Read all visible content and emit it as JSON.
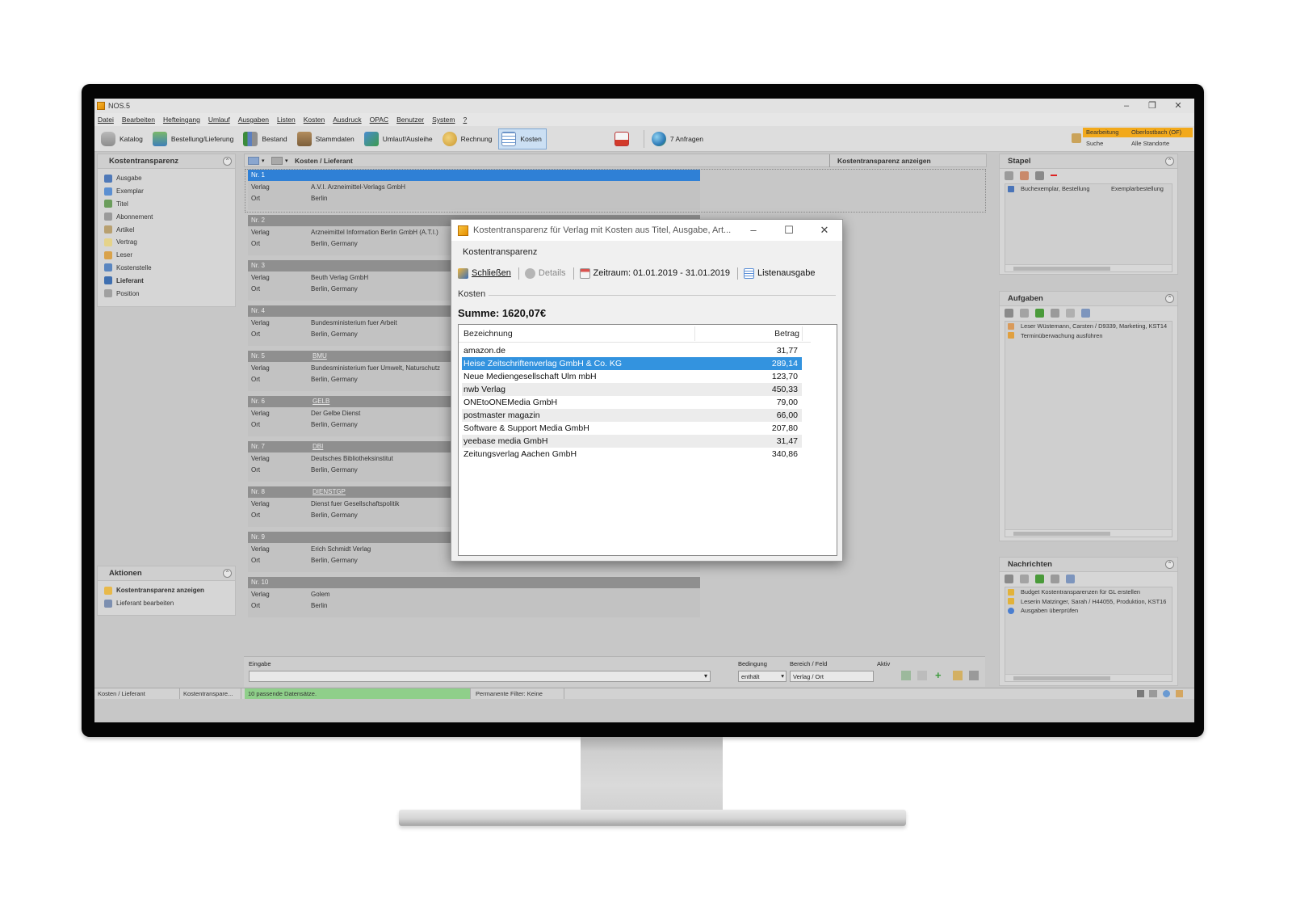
{
  "app": {
    "title": "NOS.5",
    "menu": [
      "Datei",
      "Bearbeiten",
      "Hefteingang",
      "Umlauf",
      "Ausgaben",
      "Listen",
      "Kosten",
      "Ausdruck",
      "OPAC",
      "Benutzer",
      "System",
      "?"
    ],
    "toolbar": {
      "buttons": [
        "Katalog",
        "Bestellung/Lieferung",
        "Bestand",
        "Stammdaten",
        "Umlauf/Ausleihe",
        "Rechnung",
        "Kosten"
      ],
      "requests": "7 Anfragen",
      "mode_label": "Bearbeitung",
      "mode_value": "Oberlostbach (OF)",
      "search_label": "Suche",
      "search_value": "Alle Standorte"
    }
  },
  "left_panel": {
    "title": "Kostentransparenz",
    "items": [
      "Ausgabe",
      "Exemplar",
      "Titel",
      "Abonnement",
      "Artikel",
      "Vertrag",
      "Leser",
      "Kostenstelle",
      "Lieferant",
      "Position"
    ],
    "selected": "Lieferant"
  },
  "actions_panel": {
    "title": "Aktionen",
    "items": [
      "Kostentransparenz anzeigen",
      "Lieferant bearbeiten"
    ]
  },
  "center": {
    "header_left": "Kosten / Lieferant",
    "header_right": "Kostentransparenz anzeigen",
    "records": [
      {
        "nr": "Nr. 1",
        "tag": "",
        "verlag_label": "Verlag",
        "verlag": "A.V.I. Arzneimittel-Verlags GmbH",
        "ort_label": "Ort",
        "ort": "Berlin"
      },
      {
        "nr": "Nr. 2",
        "tag": "",
        "verlag_label": "Verlag",
        "verlag": "Arzneimittel Information Berlin GmbH (A.T.I.)",
        "ort_label": "Ort",
        "ort": "Berlin, Germany"
      },
      {
        "nr": "Nr. 3",
        "tag": "",
        "verlag_label": "Verlag",
        "verlag": "Beuth Verlag GmbH",
        "ort_label": "Ort",
        "ort": "Berlin, Germany"
      },
      {
        "nr": "Nr. 4",
        "tag": "",
        "verlag_label": "Verlag",
        "verlag": "Bundesministerium fuer Arbeit",
        "ort_label": "Ort",
        "ort": "Berlin, Germany"
      },
      {
        "nr": "Nr. 5",
        "tag": "BMU",
        "verlag_label": "Verlag",
        "verlag": "Bundesministerium fuer Umwelt, Naturschutz",
        "ort_label": "Ort",
        "ort": "Berlin, Germany"
      },
      {
        "nr": "Nr. 6",
        "tag": "GELB",
        "verlag_label": "Verlag",
        "verlag": "Der Gelbe Dienst",
        "ort_label": "Ort",
        "ort": "Berlin, Germany"
      },
      {
        "nr": "Nr. 7",
        "tag": "DBI",
        "verlag_label": "Verlag",
        "verlag": "Deutsches Bibliotheksinstitut",
        "ort_label": "Ort",
        "ort": "Berlin, Germany"
      },
      {
        "nr": "Nr. 8",
        "tag": "DIENSTGP",
        "verlag_label": "Verlag",
        "verlag": "Dienst fuer Gesellschaftspolitik",
        "ort_label": "Ort",
        "ort": "Berlin, Germany"
      },
      {
        "nr": "Nr. 9",
        "tag": "",
        "verlag_label": "Verlag",
        "verlag": "Erich Schmidt Verlag",
        "ort_label": "Ort",
        "ort": "Berlin, Germany"
      },
      {
        "nr": "Nr. 10",
        "tag": "",
        "verlag_label": "Verlag",
        "verlag": "Golem",
        "ort_label": "Ort",
        "ort": "Berlin"
      }
    ]
  },
  "filter": {
    "input_label": "Eingabe",
    "condition_label": "Bedingung",
    "condition_value": "enthält",
    "field_label": "Bereich / Feld",
    "field_value": "Verlag / Ort",
    "active_label": "Aktiv"
  },
  "statusbar": {
    "cell1": "Kosten / Lieferant",
    "cell2": "Kostentranspare...",
    "cell3": "10 passende Datensätze.",
    "cell4": "Permanente Filter: Keine"
  },
  "right": {
    "stapel": {
      "title": "Stapel",
      "rows": [
        {
          "col1": "Buchexemplar, Bestellung",
          "col2": "Exemplarbestellung"
        }
      ]
    },
    "aufgaben": {
      "title": "Aufgaben",
      "rows": [
        "Leser Wüstemann, Carsten / D9339, Marketing, KST14",
        "Terminüberwachung ausführen"
      ]
    },
    "nachrichten": {
      "title": "Nachrichten",
      "rows": [
        "Budget Kostentransparenzen für GL erstellen",
        "Leserin Matzinger, Sarah / H44055, Produktion, KST16",
        "Ausgaben überprüfen"
      ]
    }
  },
  "dialog": {
    "title": "Kostentransparenz für Verlag mit Kosten aus Titel, Ausgabe, Art...",
    "subtitle": "Kostentransparenz",
    "buttons": {
      "close": "Schließen",
      "details": "Details",
      "period": "Zeitraum: 01.01.2019 - 31.01.2019",
      "list": "Listenausgabe"
    },
    "group_label": "Kosten",
    "sum": "Summe: 1620,07€",
    "columns": {
      "name": "Bezeichnung",
      "amount": "Betrag"
    },
    "rows": [
      {
        "name": "amazon.de",
        "amount": "31,77"
      },
      {
        "name": "Heise Zeitschriftenverlag GmbH & Co. KG",
        "amount": "289,14"
      },
      {
        "name": "Neue Mediengesellschaft Ulm mbH",
        "amount": "123,70"
      },
      {
        "name": "nwb Verlag",
        "amount": "450,33"
      },
      {
        "name": "ONEtoONEMedia GmbH",
        "amount": "79,00"
      },
      {
        "name": "postmaster magazin",
        "amount": "66,00"
      },
      {
        "name": "Software & Support Media GmbH",
        "amount": "207,80"
      },
      {
        "name": "yeebase media GmbH",
        "amount": "31,47"
      },
      {
        "name": "Zeitungsverlag Aachen GmbH",
        "amount": "340,86"
      }
    ],
    "selected_row": "Heise Zeitschriftenverlag GmbH & Co. KG"
  }
}
